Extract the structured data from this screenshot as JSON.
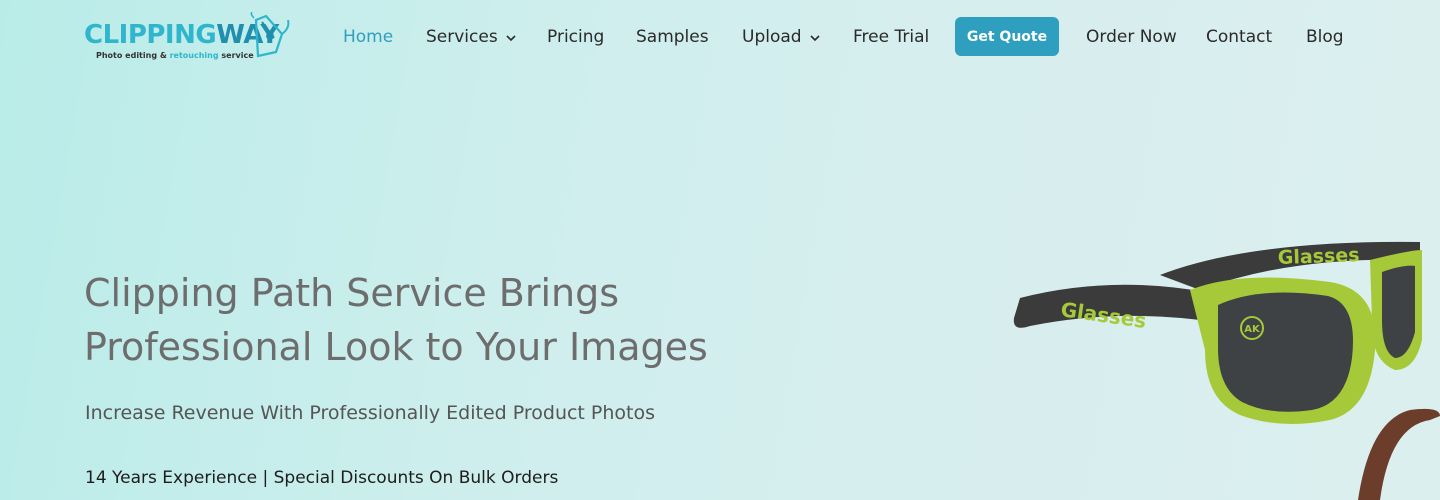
{
  "logo": {
    "word_a": "CLIPPING",
    "word_b": "WAY",
    "tagline_a": "Photo editing &",
    "tagline_b": "retouching",
    "tagline_c": "service"
  },
  "nav": {
    "home": "Home",
    "services": "Services",
    "pricing": "Pricing",
    "samples": "Samples",
    "upload": "Upload",
    "free_trial": "Free Trial",
    "get_quote": "Get Quote",
    "order_now": "Order Now",
    "contact": "Contact",
    "blog": "Blog"
  },
  "hero": {
    "title_line1": "Clipping Path Service Brings",
    "title_line2": "Professional Look to Your Images",
    "subtitle": "Increase Revenue With Professionally Edited Product Photos",
    "meta": "14 Years Experience | Special Discounts On Bulk Orders"
  },
  "product_image": {
    "temple_text_left": "Glasses",
    "temple_text_right": "Glasses",
    "lens_mark": "AK"
  },
  "colors": {
    "accent": "#2f9fbf",
    "logo_cyan": "#2fb6cd",
    "frame_green": "#a6c93a",
    "temple_dark": "#3b3b3b"
  },
  "icons": {
    "dropdown": "chevron-down-icon",
    "logo_mark": "pen-nib-icon"
  }
}
